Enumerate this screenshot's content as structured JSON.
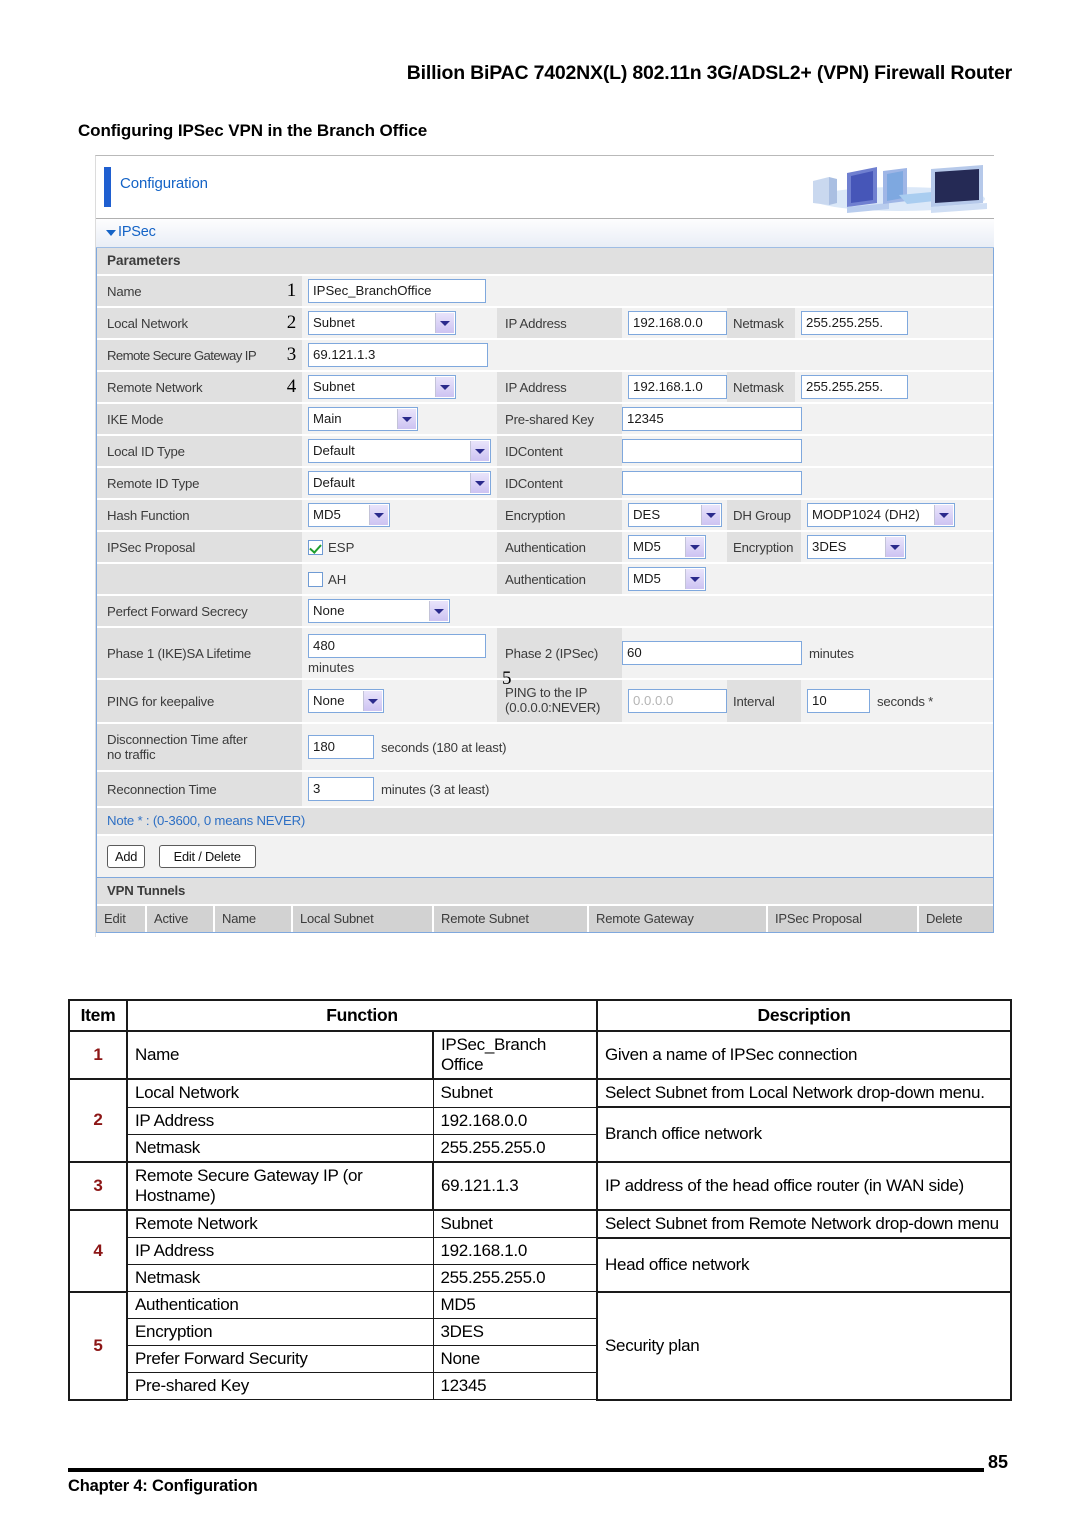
{
  "document": {
    "running_head": "Billion BiPAC 7402NX(L) 802.11n 3G/ADSL2+ (VPN) Firewall Router",
    "section_heading": "Configuring IPSec VPN in the Branch Office",
    "footer_chapter_prefix": "Chapter 4:",
    "footer_chapter_name": "Configuration",
    "page_number": "85"
  },
  "router_ui": {
    "panel_title": "Configuration",
    "section_title": "IPSec",
    "parameters_label": "Parameters",
    "banner_icon": "computers-banner-image",
    "rows": {
      "name": {
        "label": "Name",
        "callout": "1",
        "value": "IPSec_BranchOffice"
      },
      "local_network": {
        "label": "Local Network",
        "callout": "2",
        "select": "Subnet",
        "ip_label": "IP Address",
        "ip_value": "192.168.0.0",
        "netmask_label": "Netmask",
        "netmask_value": "255.255.255."
      },
      "remote_secure_gateway": {
        "label": "Remote Secure Gateway IP",
        "callout": "3",
        "value": "69.121.1.3"
      },
      "remote_network": {
        "label": "Remote Network",
        "callout": "4",
        "select": "Subnet",
        "ip_label": "IP Address",
        "ip_value": "192.168.1.0",
        "netmask_label": "Netmask",
        "netmask_value": "255.255.255."
      },
      "ike_mode": {
        "label": "IKE Mode",
        "select": "Main",
        "psk_label": "Pre-shared Key",
        "psk_value": "12345"
      },
      "local_id_type": {
        "label": "Local ID Type",
        "select": "Default",
        "idcontent_label": "IDContent",
        "idcontent_value": ""
      },
      "remote_id_type": {
        "label": "Remote ID Type",
        "select": "Default",
        "idcontent_label": "IDContent",
        "idcontent_value": ""
      },
      "hash_function": {
        "label": "Hash Function",
        "callout": "5",
        "select": "MD5",
        "encryption_label": "Encryption",
        "encryption_value": "DES",
        "dh_group_label": "DH Group",
        "dh_group_value": "MODP1024 (DH2)"
      },
      "ipsec_proposal_esp": {
        "label": "IPSec Proposal",
        "checkbox_label": "ESP",
        "checkbox_checked": true,
        "auth_label": "Authentication",
        "auth_value": "MD5",
        "encryption_label": "Encryption",
        "encryption_value": "3DES"
      },
      "ipsec_proposal_ah": {
        "label": "",
        "checkbox_label": "AH",
        "checkbox_checked": false,
        "auth_label": "Authentication",
        "auth_value": "MD5"
      },
      "pfs": {
        "label": "Perfect Forward Secrecy",
        "select": "None"
      },
      "phase1": {
        "label": "Phase 1 (IKE)SA Lifetime",
        "value": "480",
        "unit": "minutes",
        "phase2_label": "Phase 2 (IPSec)",
        "phase2_value": "60",
        "phase2_unit": "minutes"
      },
      "ping_keepalive": {
        "label": "PING for keepalive",
        "select": "None",
        "ping_ip_label_line1": "PING to the IP",
        "ping_ip_label_line2": "(0.0.0.0:NEVER)",
        "ping_ip_placeholder": "0.0.0.0",
        "interval_label": "Interval",
        "interval_value": "10",
        "interval_unit": "seconds *"
      },
      "disconnection": {
        "label_line1": "Disconnection Time after",
        "label_line2": "no traffic",
        "value": "180",
        "unit": "seconds (180 at least)"
      },
      "reconnection": {
        "label": "Reconnection Time",
        "value": "3",
        "unit": "minutes (3 at least)"
      }
    },
    "note": "Note * : (0-3600, 0 means NEVER)",
    "buttons": {
      "add": "Add",
      "edit_delete": "Edit / Delete"
    },
    "vpn_tunnels": {
      "title": "VPN Tunnels",
      "columns": [
        "Edit",
        "Active",
        "Name",
        "Local Subnet",
        "Remote Subnet",
        "Remote Gateway",
        "IPSec Proposal",
        "Delete"
      ]
    }
  },
  "reference_table": {
    "headers": [
      "Item",
      "Function",
      "Description"
    ],
    "rows": [
      {
        "item": "1",
        "function": "Name",
        "value": "IPSec_Branch Office",
        "description": "Given a name of IPSec connection"
      },
      {
        "item": "2",
        "function": "Local Network",
        "value": "Subnet",
        "description": "Select Subnet from Local Network drop-down menu."
      },
      {
        "item": "",
        "function": "IP Address",
        "value": "192.168.0.0",
        "description": "Branch office network"
      },
      {
        "item": "",
        "function": "Netmask",
        "value": "255.255.255.0",
        "description": ""
      },
      {
        "item": "3",
        "function": "Remote Secure Gateway IP (or Hostname)",
        "value": "69.121.1.3",
        "description": "IP address of the head office router (in WAN side)"
      },
      {
        "item": "4",
        "function": "Remote Network",
        "value": "Subnet",
        "description": "Select Subnet from Remote Network drop-down menu"
      },
      {
        "item": "",
        "function": "IP Address",
        "value": "192.168.1.0",
        "description": "Head office network"
      },
      {
        "item": "",
        "function": "Netmask",
        "value": "255.255.255.0",
        "description": ""
      },
      {
        "item": "5",
        "function": "Authentication",
        "value": "MD5",
        "description": "Security plan"
      },
      {
        "item": "",
        "function": "Encryption",
        "value": "3DES",
        "description": ""
      },
      {
        "item": "",
        "function": "Prefer Forward Security",
        "value": "None",
        "description": ""
      },
      {
        "item": "",
        "function": "Pre-shared Key",
        "value": "12345",
        "description": ""
      }
    ]
  },
  "colors": {
    "accent_blue": "#1463c6",
    "callout_red": "#8c1616",
    "label_grey": "#e0e0e0",
    "field_grey": "#f2f2f2"
  }
}
